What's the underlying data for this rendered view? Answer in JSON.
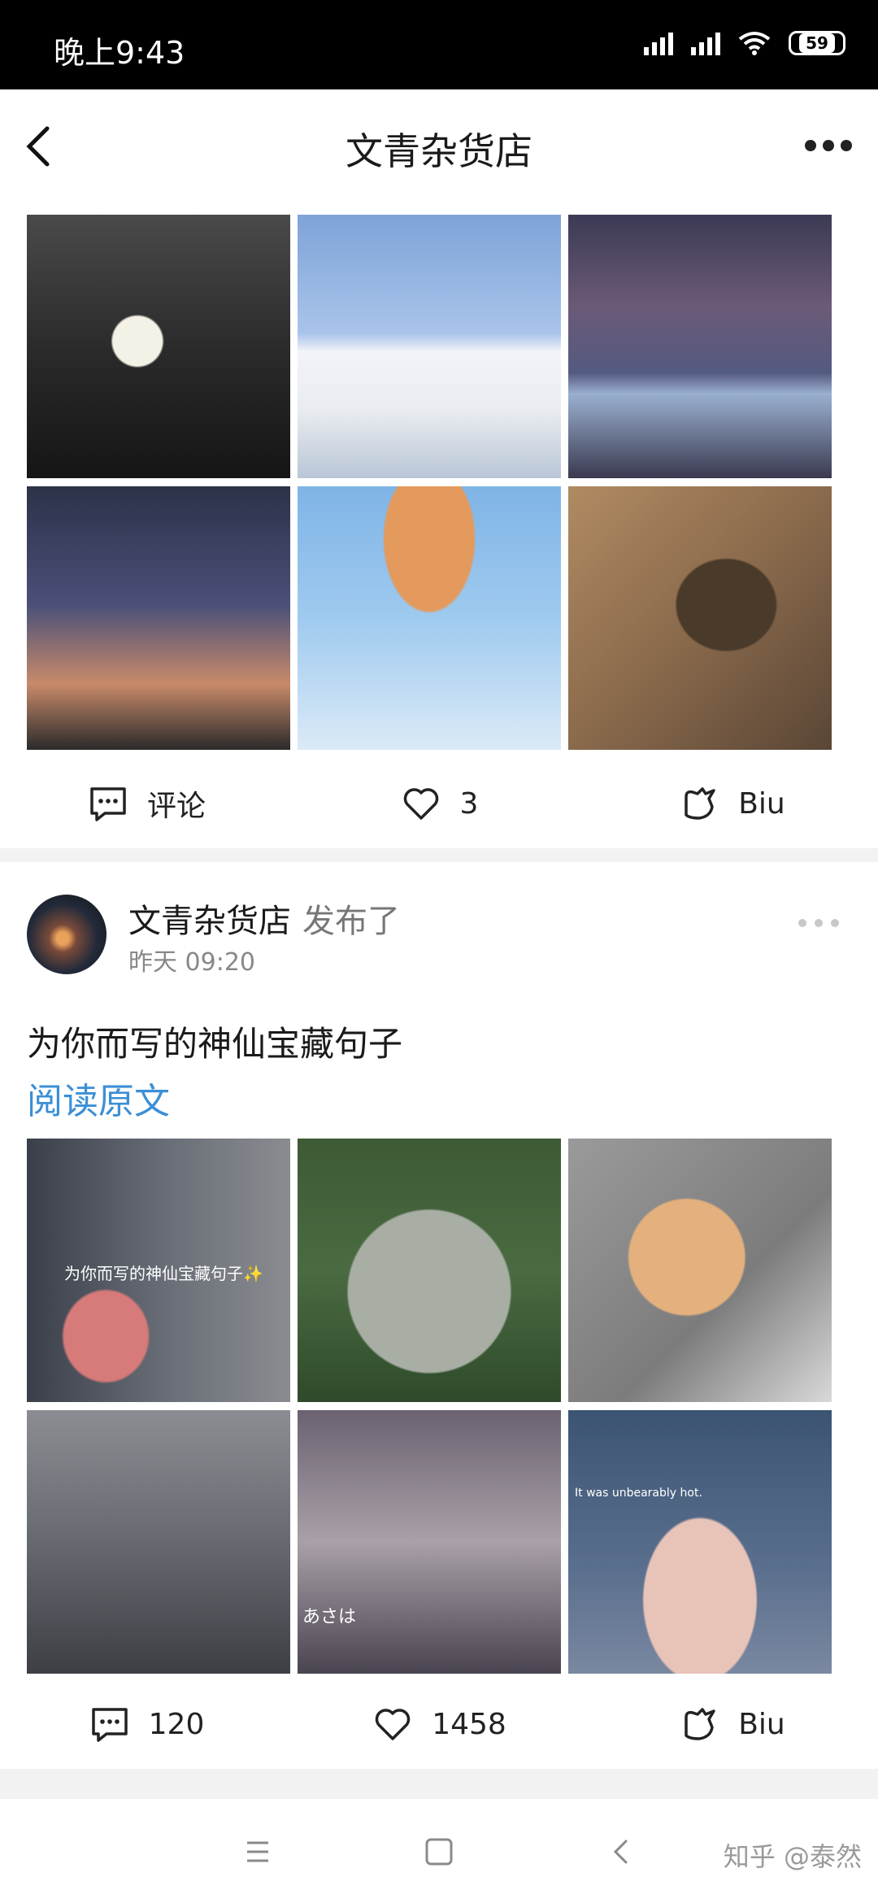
{
  "status_bar": {
    "time": "晚上9:43",
    "battery": "59"
  },
  "nav": {
    "title": "文青杂货店"
  },
  "post1": {
    "actions": {
      "comment_label": "评论",
      "like_count": "3",
      "biu_label": "Biu"
    }
  },
  "post2": {
    "author": "文青杂货店",
    "verb": "发布了",
    "time": "昨天 09:20",
    "title": "为你而写的神仙宝藏句子",
    "read_link": "阅读原文",
    "photo_captions": {
      "p1": "为你而写的神仙宝藏句子✨",
      "p5": "あさは",
      "p6": "It was unbearably hot."
    },
    "actions": {
      "comment_count": "120",
      "like_count": "1458",
      "biu_label": "Biu"
    }
  },
  "watermark": "知乎 @泰然",
  "colors": {
    "link": "#3b8fd6",
    "status_bar": "#000000",
    "background": "#f2f2f2"
  }
}
